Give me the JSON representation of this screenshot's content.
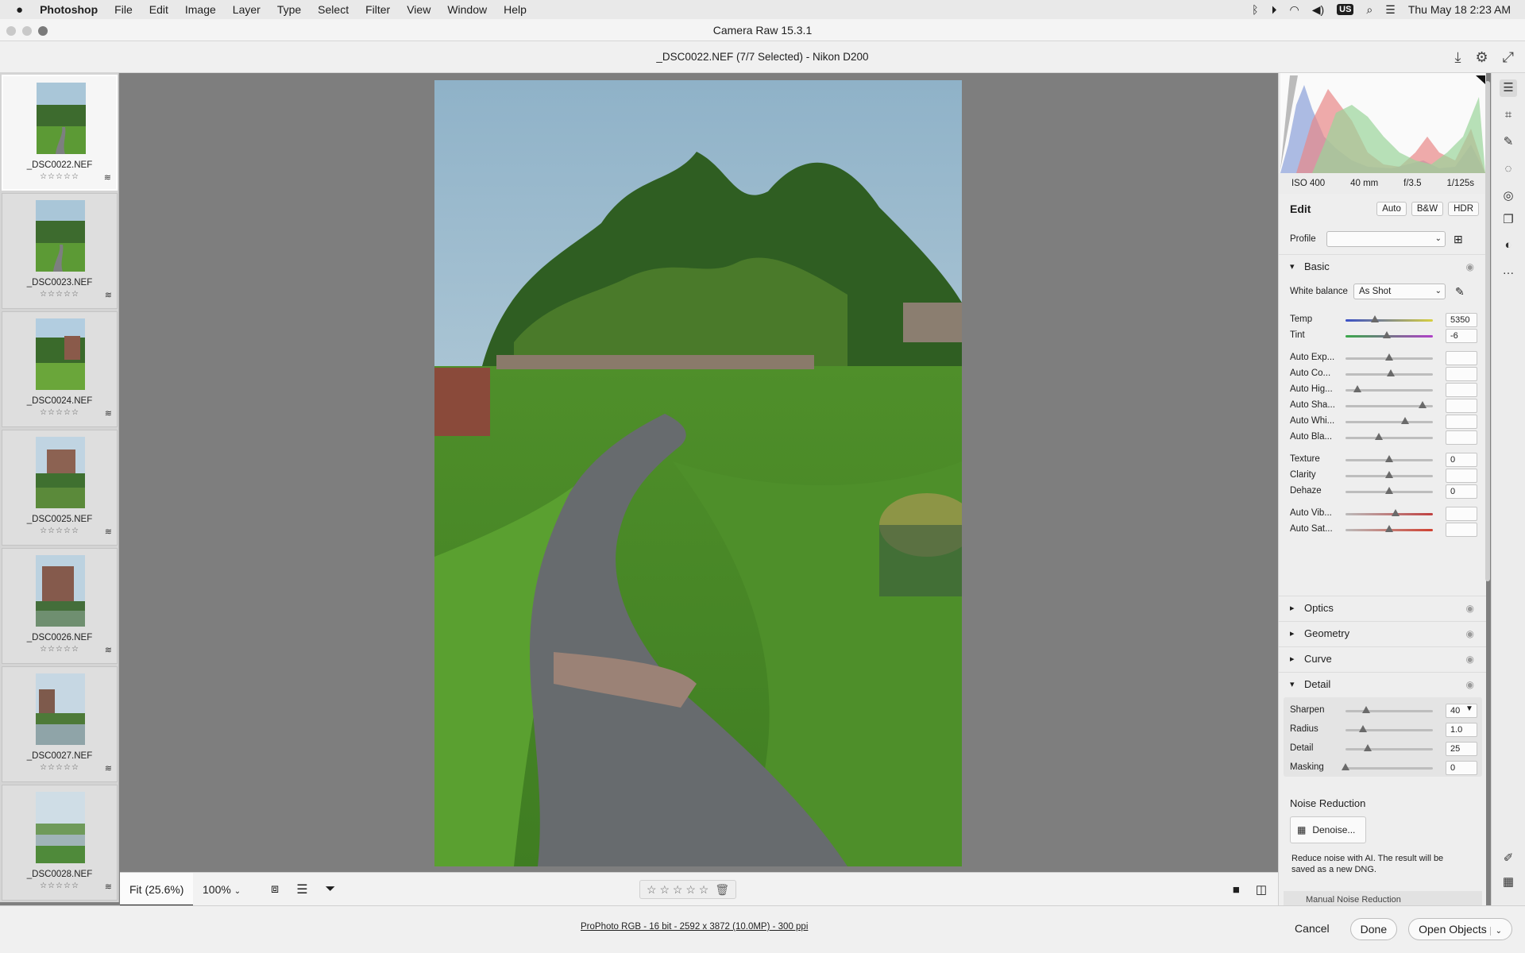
{
  "menubar": {
    "app": "Photoshop",
    "items": [
      "File",
      "Edit",
      "Image",
      "Layer",
      "Type",
      "Select",
      "Filter",
      "View",
      "Window",
      "Help"
    ],
    "input_source": "US",
    "clock": "Thu May 18  2:23 AM"
  },
  "window": {
    "title": "Camera Raw 15.3.1"
  },
  "filebar": {
    "title": "_DSC0022.NEF (7/7 Selected)  -  Nikon D200"
  },
  "filmstrip": [
    {
      "name": "_DSC0022.NEF",
      "stars": "☆☆☆☆☆",
      "selected": true
    },
    {
      "name": "_DSC0023.NEF",
      "stars": "☆☆☆☆☆",
      "selected": false
    },
    {
      "name": "_DSC0024.NEF",
      "stars": "☆☆☆☆☆",
      "selected": false
    },
    {
      "name": "_DSC0025.NEF",
      "stars": "☆☆☆☆☆",
      "selected": false
    },
    {
      "name": "_DSC0026.NEF",
      "stars": "☆☆☆☆☆",
      "selected": false
    },
    {
      "name": "_DSC0027.NEF",
      "stars": "☆☆☆☆☆",
      "selected": false
    },
    {
      "name": "_DSC0028.NEF",
      "stars": "☆☆☆☆☆",
      "selected": false
    }
  ],
  "bottombar": {
    "fit": "Fit (25.6%)",
    "zoom": "100%",
    "stars": "☆ ☆ ☆ ☆ ☆"
  },
  "status": {
    "info": "ProPhoto RGB - 16 bit - 2592 x 3872 (10.0MP) - 300 ppi",
    "cancel": "Cancel",
    "done": "Done",
    "open": "Open Objects"
  },
  "camera": {
    "iso": "ISO 400",
    "focal": "40 mm",
    "aperture": "f/3.5",
    "shutter": "1/125s"
  },
  "edit": {
    "title": "Edit",
    "auto": "Auto",
    "bw": "B&W",
    "hdr": "HDR",
    "profile_label": "Profile",
    "profile_value": ""
  },
  "basic": {
    "title": "Basic",
    "wb_label": "White balance",
    "wb_value": "As Shot",
    "sliders": [
      {
        "label": "Temp",
        "value": "5350",
        "pos": 0.34
      },
      {
        "label": "Tint",
        "value": "-6",
        "pos": 0.47
      },
      {
        "label": "Auto Exp...",
        "value": "",
        "pos": 0.5
      },
      {
        "label": "Auto Co...",
        "value": "",
        "pos": 0.52
      },
      {
        "label": "Auto Hig...",
        "value": "",
        "pos": 0.14
      },
      {
        "label": "Auto Sha...",
        "value": "",
        "pos": 0.88
      },
      {
        "label": "Auto Whi...",
        "value": "",
        "pos": 0.68
      },
      {
        "label": "Auto Bla...",
        "value": "",
        "pos": 0.38
      },
      {
        "label": "Texture",
        "value": "0",
        "pos": 0.5
      },
      {
        "label": "Clarity",
        "value": "",
        "pos": 0.5
      },
      {
        "label": "Dehaze",
        "value": "0",
        "pos": 0.5
      },
      {
        "label": "Auto Vib...",
        "value": "",
        "pos": 0.57
      },
      {
        "label": "Auto Sat...",
        "value": "",
        "pos": 0.5
      }
    ]
  },
  "sections": {
    "optics": "Optics",
    "geometry": "Geometry",
    "curve": "Curve",
    "detail": "Detail"
  },
  "detail": {
    "sliders": [
      {
        "label": "Sharpen",
        "value": "40",
        "pos": 0.24
      },
      {
        "label": "Radius",
        "value": "1.0",
        "pos": 0.2
      },
      {
        "label": "Detail",
        "value": "25",
        "pos": 0.25
      },
      {
        "label": "Masking",
        "value": "0",
        "pos": 0.0
      }
    ]
  },
  "noise": {
    "title": "Noise Reduction",
    "denoise": "Denoise...",
    "desc": "Reduce noise with AI. The result will be saved as a new DNG.",
    "manual": "Manual Noise Reduction"
  }
}
